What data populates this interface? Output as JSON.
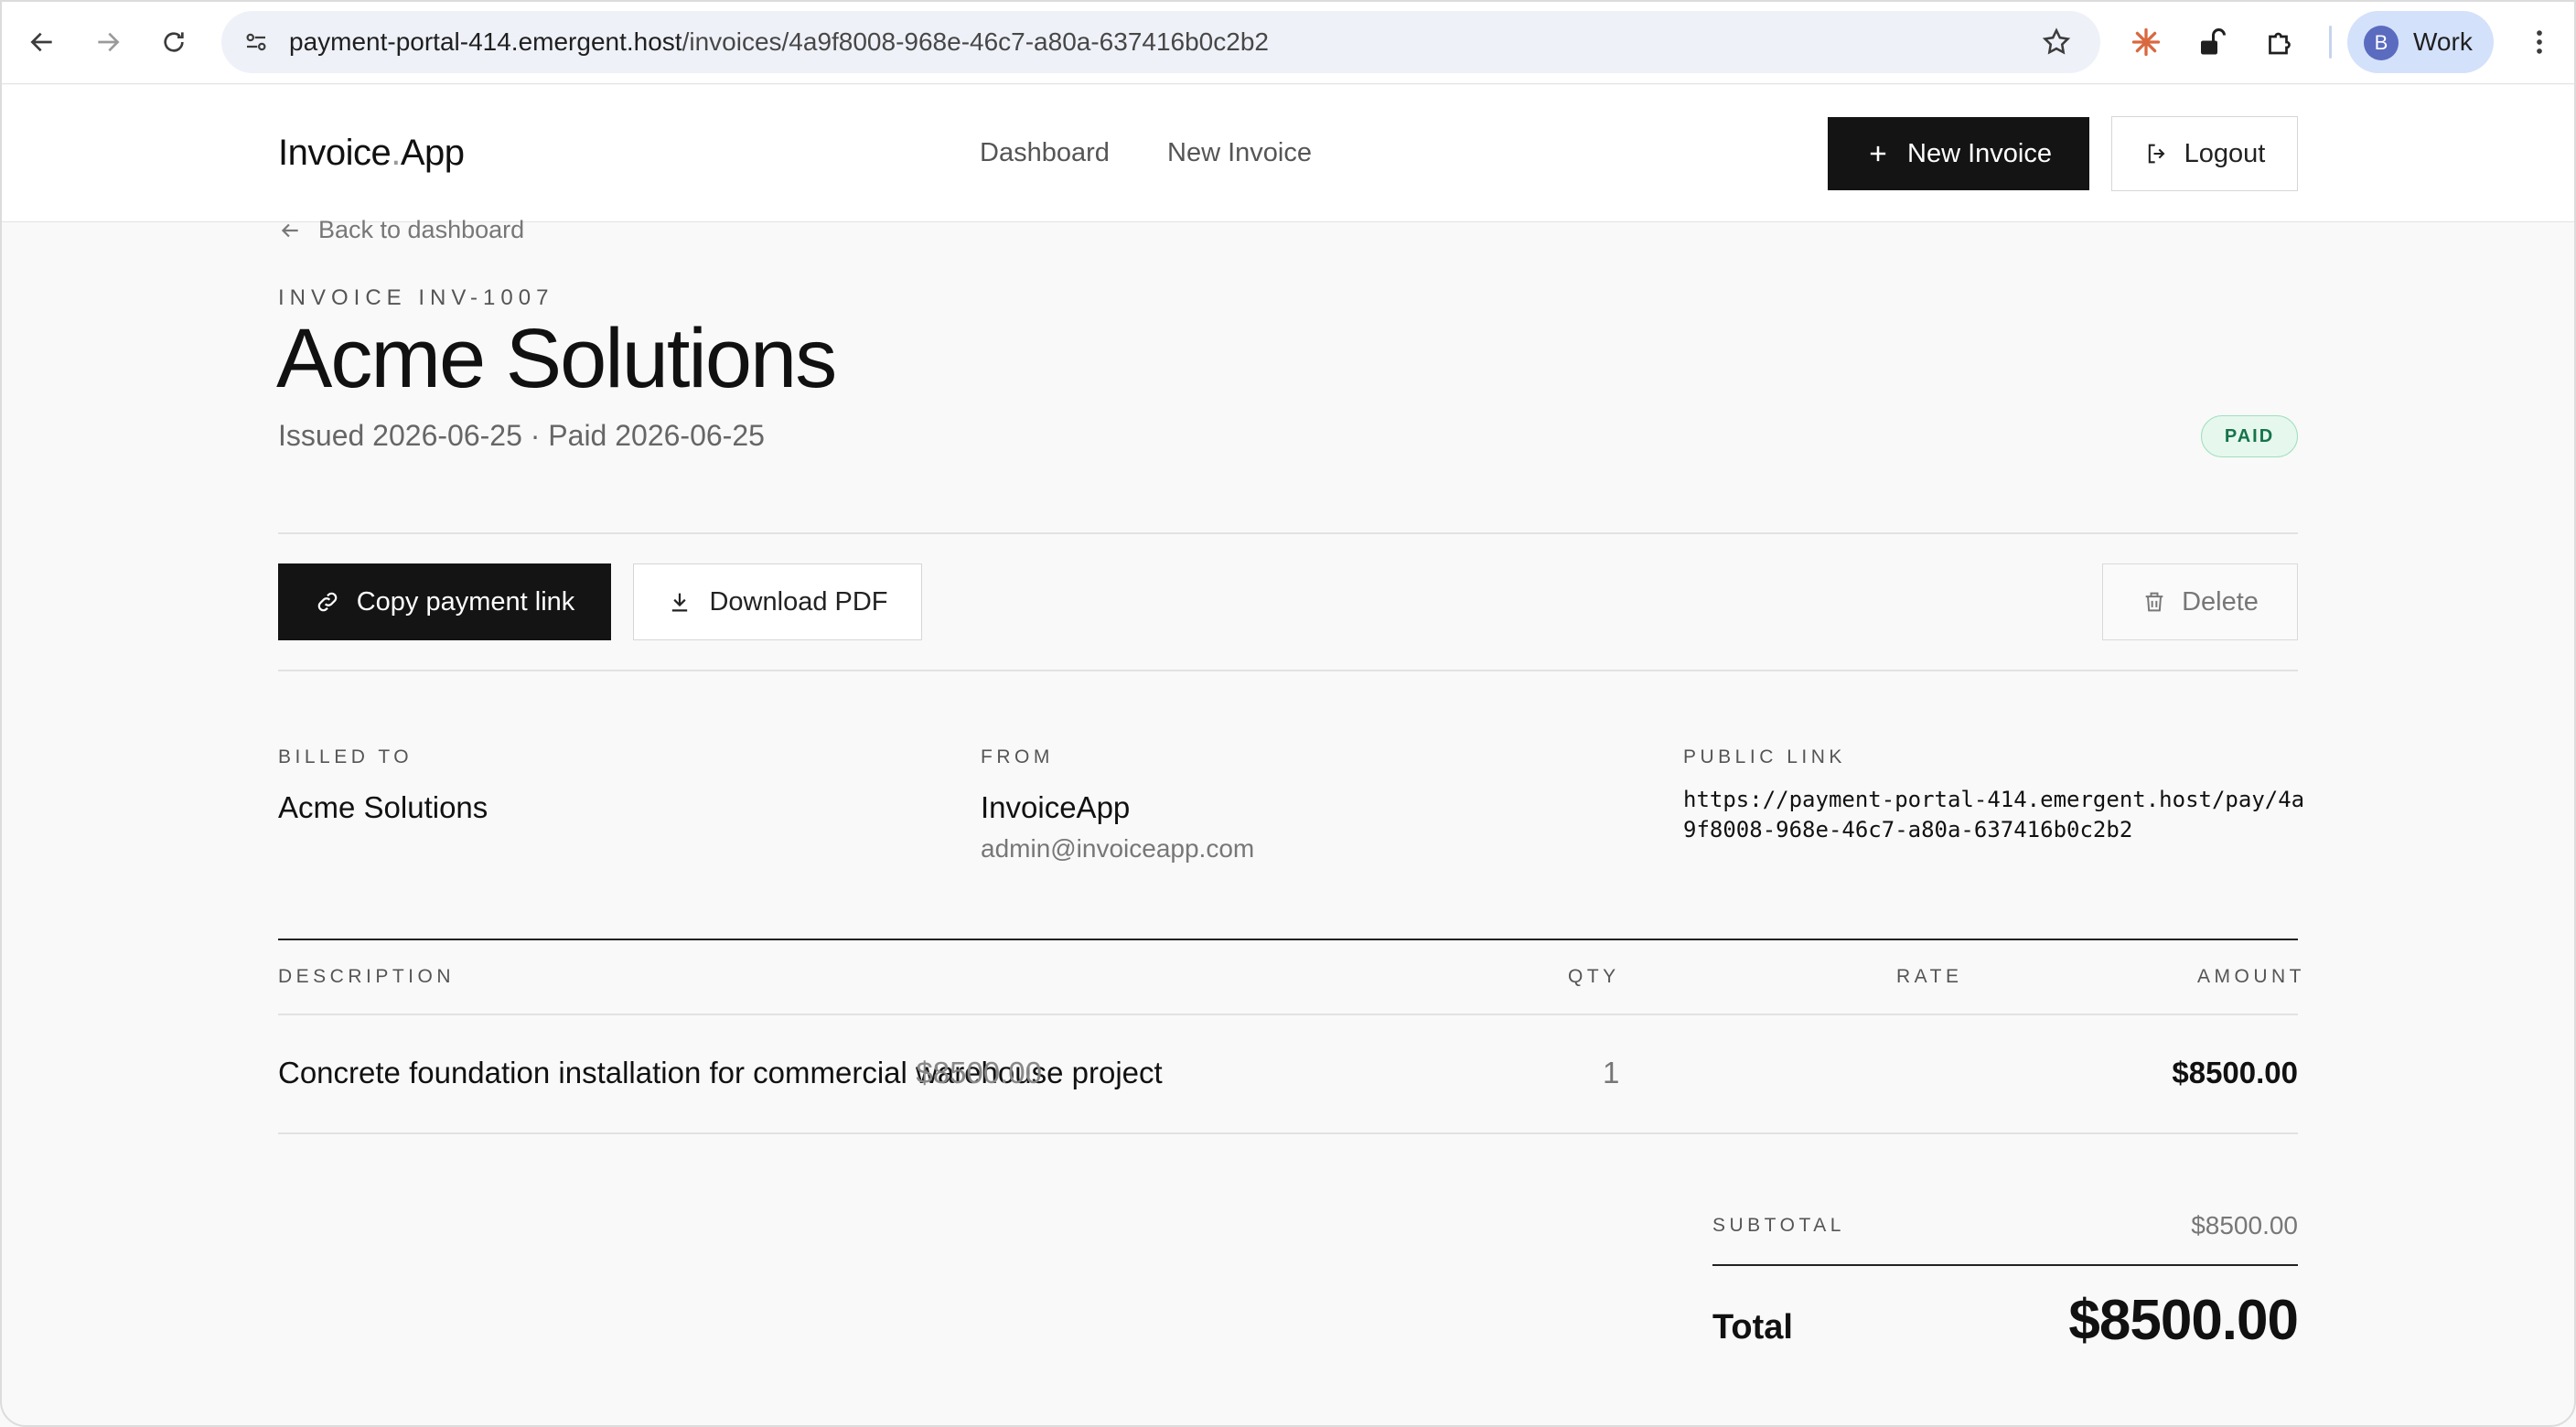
{
  "browser": {
    "url_host": "payment-portal-414.emergent.host",
    "url_path": "/invoices/4a9f8008-968e-46c7-a80a-637416b0c2b2",
    "profile_initial": "B",
    "profile_label": "Work"
  },
  "header": {
    "brand_left": "Invoice",
    "brand_dot": ".",
    "brand_right": "App",
    "nav": [
      "Dashboard",
      "New Invoice"
    ],
    "new_invoice_label": "New Invoice",
    "logout_label": "Logout"
  },
  "invoice": {
    "back_label": "Back to dashboard",
    "eyebrow": "INVOICE INV-1007",
    "title": "Acme Solutions",
    "subtitle": "Issued 2026-06-25 · Paid 2026-06-25",
    "status": "PAID",
    "actions": {
      "copy_label": "Copy payment link",
      "pdf_label": "Download PDF",
      "delete_label": "Delete"
    },
    "billed_to": {
      "label": "BILLED TO",
      "name": "Acme Solutions"
    },
    "from": {
      "label": "FROM",
      "name": "InvoiceApp",
      "email": "admin@invoiceapp.com"
    },
    "public_link": {
      "label": "PUBLIC LINK",
      "url": "https://payment-portal-414.emergent.host/pay/4a9f8008-968e-46c7-a80a-637416b0c2b2"
    },
    "table": {
      "headers": {
        "description": "DESCRIPTION",
        "qty": "QTY",
        "rate": "RATE",
        "amount": "AMOUNT"
      },
      "rows": [
        {
          "description": "Concrete foundation installation for commercial warehouse project",
          "qty": "1",
          "rate": "$8500.00",
          "amount": "$8500.00"
        }
      ]
    },
    "subtotal_label": "SUBTOTAL",
    "subtotal": "$8500.00",
    "total_label": "Total",
    "total": "$8500.00"
  }
}
